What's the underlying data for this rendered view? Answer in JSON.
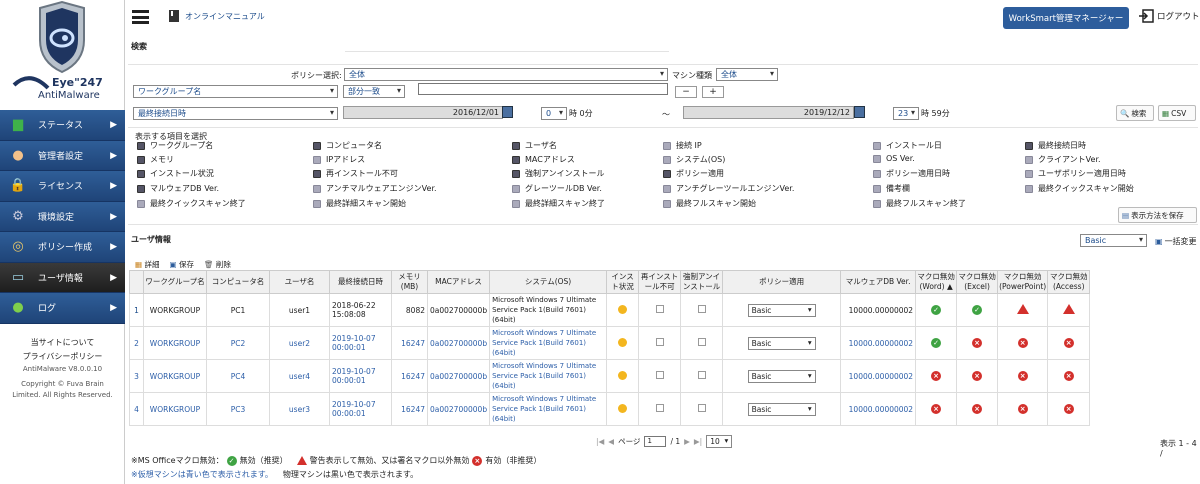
{
  "brand": {
    "line1": "Eye\"247",
    "line2": "AntiMalware"
  },
  "sidebar": {
    "items": [
      {
        "label": "ステータス",
        "icon": "chart-icon"
      },
      {
        "label": "管理者設定",
        "icon": "person-icon"
      },
      {
        "label": "ライセンス",
        "icon": "lock-icon"
      },
      {
        "label": "環境設定",
        "icon": "gear-icon"
      },
      {
        "label": "ポリシー作成",
        "icon": "compass-icon"
      },
      {
        "label": "ユーザ情報",
        "icon": "monitor-icon"
      },
      {
        "label": "ログ",
        "icon": "speech-icon"
      }
    ],
    "arrow": "▶",
    "footer": {
      "about": "当サイトについて",
      "privacy": "プライバシーポリシー",
      "version": "AntiMalware V8.0.0.10",
      "copyright1": "Copyright © Fuva Brain",
      "copyright2": "Limited. All Rights Reserved."
    }
  },
  "header": {
    "manual": "オンラインマニュアル",
    "ws_button": "WorkSmart管理マネージャー",
    "logout": "ログアウト"
  },
  "search": {
    "title": "検索",
    "policy_label": "ポリシー選択:",
    "policy_value": "全体",
    "machine_label": "マシン種類",
    "machine_value": "全体",
    "field1": "ワークグループ名",
    "match": "部分一致",
    "plus": "+",
    "minus": "−",
    "field2": "最終接続日時",
    "date_from": "2016/12/01",
    "hour_from": "0",
    "unit_from": "時 0分",
    "tilde": "〜",
    "date_to": "2019/12/12",
    "hour_to": "23",
    "unit_to": "時 59分",
    "search_btn": "検索",
    "csv_btn": "CSV"
  },
  "columns": {
    "legend": "表示する項目を選択",
    "save_btn": "表示方法を保存",
    "items": [
      [
        "ワークグループ名",
        true
      ],
      [
        "コンピュータ名",
        true
      ],
      [
        "ユーザ名",
        true
      ],
      [
        "接続 IP",
        false
      ],
      [
        "インストール日",
        false
      ],
      [
        "最終接続日時",
        true
      ],
      [
        "メモリ",
        true
      ],
      [
        "IPアドレス",
        false
      ],
      [
        "MACアドレス",
        true
      ],
      [
        "システム(OS)",
        false
      ],
      [
        "OS Ver.",
        false
      ],
      [
        "クライアントVer.",
        false
      ],
      [
        "インストール状況",
        true
      ],
      [
        "再インストール不可",
        true
      ],
      [
        "強制アンインストール",
        true
      ],
      [
        "ポリシー適用",
        true
      ],
      [
        "ポリシー適用日時",
        false
      ],
      [
        "ユーザポリシー適用日時",
        false
      ],
      [
        "マルウェアDB Ver.",
        true
      ],
      [
        "アンチマルウェアエンジンVer.",
        false
      ],
      [
        "グレーツールDB Ver.",
        false
      ],
      [
        "アンチグレーツールエンジンVer.",
        false
      ],
      [
        "備考欄",
        false
      ],
      [
        "最終クイックスキャン開始",
        false
      ],
      [
        "最終クイックスキャン終了",
        false
      ],
      [
        "最終詳細スキャン開始",
        false
      ],
      [
        "最終詳細スキャン終了",
        false
      ],
      [
        "最終フルスキャン開始",
        false
      ],
      [
        "最終フルスキャン終了",
        false
      ]
    ]
  },
  "users": {
    "title": "ユーザ情報",
    "policy_value": "Basic",
    "bulk_btn": "一括変更",
    "detail": "詳細",
    "save": "保存",
    "delete": "削除",
    "headers": [
      "",
      "ワークグループ名",
      "コンピュータ名",
      "ユーザ名",
      "最終接続日時",
      "メモリ(MB)",
      "MACアドレス",
      "システム(OS)",
      "インスト状況",
      "再インストール不可",
      "強制アンインストール",
      "ポリシー適用",
      "マルウェアDB Ver.",
      "マクロ無効(Word) ▲",
      "マクロ無効(Excel)",
      "マクロ無効(PowerPoint)",
      "マクロ無効(Access)"
    ],
    "rows": [
      {
        "n": "1",
        "wg": "WORKGROUP",
        "pc": "PC1",
        "user": "user1",
        "date": "2018-06-22 15:08:08",
        "mem": "8082",
        "mac": "0a002700000b",
        "os": "Microsoft Windows 7 Ultimate Service Pack 1(Build 7601) (64bit)",
        "policy": "Basic",
        "db": "10000.00000002",
        "m": [
          "ok",
          "ok",
          "warn",
          "warn"
        ],
        "blue": false
      },
      {
        "n": "2",
        "wg": "WORKGROUP",
        "pc": "PC2",
        "user": "user2",
        "date": "2019-10-07 00:00:01",
        "mem": "16247",
        "mac": "0a002700000b",
        "os": "Microsoft Windows 7 Ultimate Service Pack 1(Build 7601) (64bit)",
        "policy": "Basic",
        "db": "10000.00000002",
        "m": [
          "ok",
          "ng",
          "ng",
          "ng"
        ],
        "blue": true
      },
      {
        "n": "3",
        "wg": "WORKGROUP",
        "pc": "PC4",
        "user": "user4",
        "date": "2019-10-07 00:00:01",
        "mem": "16247",
        "mac": "0a002700000b",
        "os": "Microsoft Windows 7 Ultimate Service Pack 1(Build 7601) (64bit)",
        "policy": "Basic",
        "db": "10000.00000002",
        "m": [
          "ng",
          "ng",
          "ng",
          "ng"
        ],
        "blue": true
      },
      {
        "n": "4",
        "wg": "WORKGROUP",
        "pc": "PC3",
        "user": "user3",
        "date": "2019-10-07 00:00:01",
        "mem": "16247",
        "mac": "0a002700000b",
        "os": "Microsoft Windows 7 Ultimate Service Pack 1(Build 7601) (64bit)",
        "policy": "Basic",
        "db": "10000.00000002",
        "m": [
          "ng",
          "ng",
          "ng",
          "ng"
        ],
        "blue": true
      }
    ]
  },
  "pager": {
    "page_label": "ページ",
    "page": "1",
    "total": "/ 1",
    "per_page": "10",
    "count": "表示 1 - 4 /"
  },
  "notes": {
    "line1a": "※MS Officeマクロ無効：",
    "ok": "無効（推奨）",
    "warn": "警告表示して無効、又は署名マクロ以外無効",
    "ng": "有効（非推奨）",
    "line2": "※仮想マシンは青い色で表示されます。",
    "line2b": "物理マシンは黒い色で表示されます。"
  }
}
